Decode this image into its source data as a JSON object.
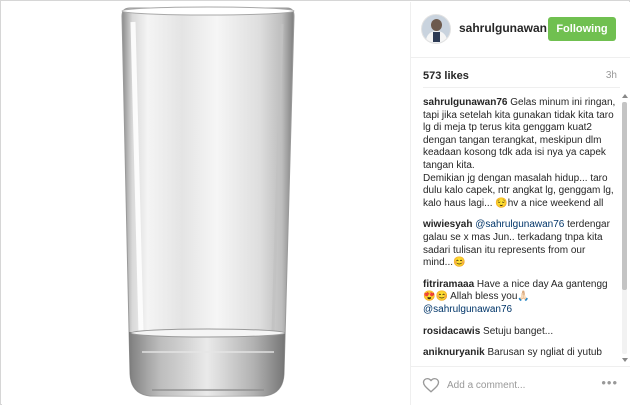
{
  "post": {
    "username": "sahrulgunawan...",
    "follow_label": "Following",
    "likes": "573 likes",
    "time": "3h",
    "add_comment_placeholder": "Add a comment...",
    "more_label": "•••"
  },
  "comments": [
    {
      "author": "sahrulgunawan76",
      "text": "Gelas minum ini ringan, tapi jika setelah kita gunakan tidak kita taro lg di meja tp terus kita genggam kuat2 dengan tangan terangkat, meskipun dlm keadaan kosong tdk ada isi nya ya capek tangan kita.",
      "text2": "Demikian jg dengan masalah hidup... taro dulu kalo capek, ntr angkat lg, genggam lg, kalo haus lagi... 😌hv a nice weekend all"
    },
    {
      "author": "wiwiesyah",
      "mention": "@sahrulgunawan76",
      "text": "terdengar galau se x mas Jun.. terkadang tnpa kita sadari tulisan itu represents from our mind...😊"
    },
    {
      "author": "fitriramaaa",
      "text": "Have a nice day Aa gantengg😍😊 Allah bless you🙏🏻",
      "mention": "@sahrulgunawan76"
    },
    {
      "author": "rosidacawis",
      "text": "Setuju banget..."
    },
    {
      "author": "aniknuryanik",
      "text": "Barusan sy ngliat di yutub"
    }
  ],
  "colors": {
    "follow_button": "#70c050",
    "mention": "#003569",
    "muted": "#999999"
  },
  "icons": {
    "like": "heart-icon",
    "options": "more-options-icon"
  }
}
